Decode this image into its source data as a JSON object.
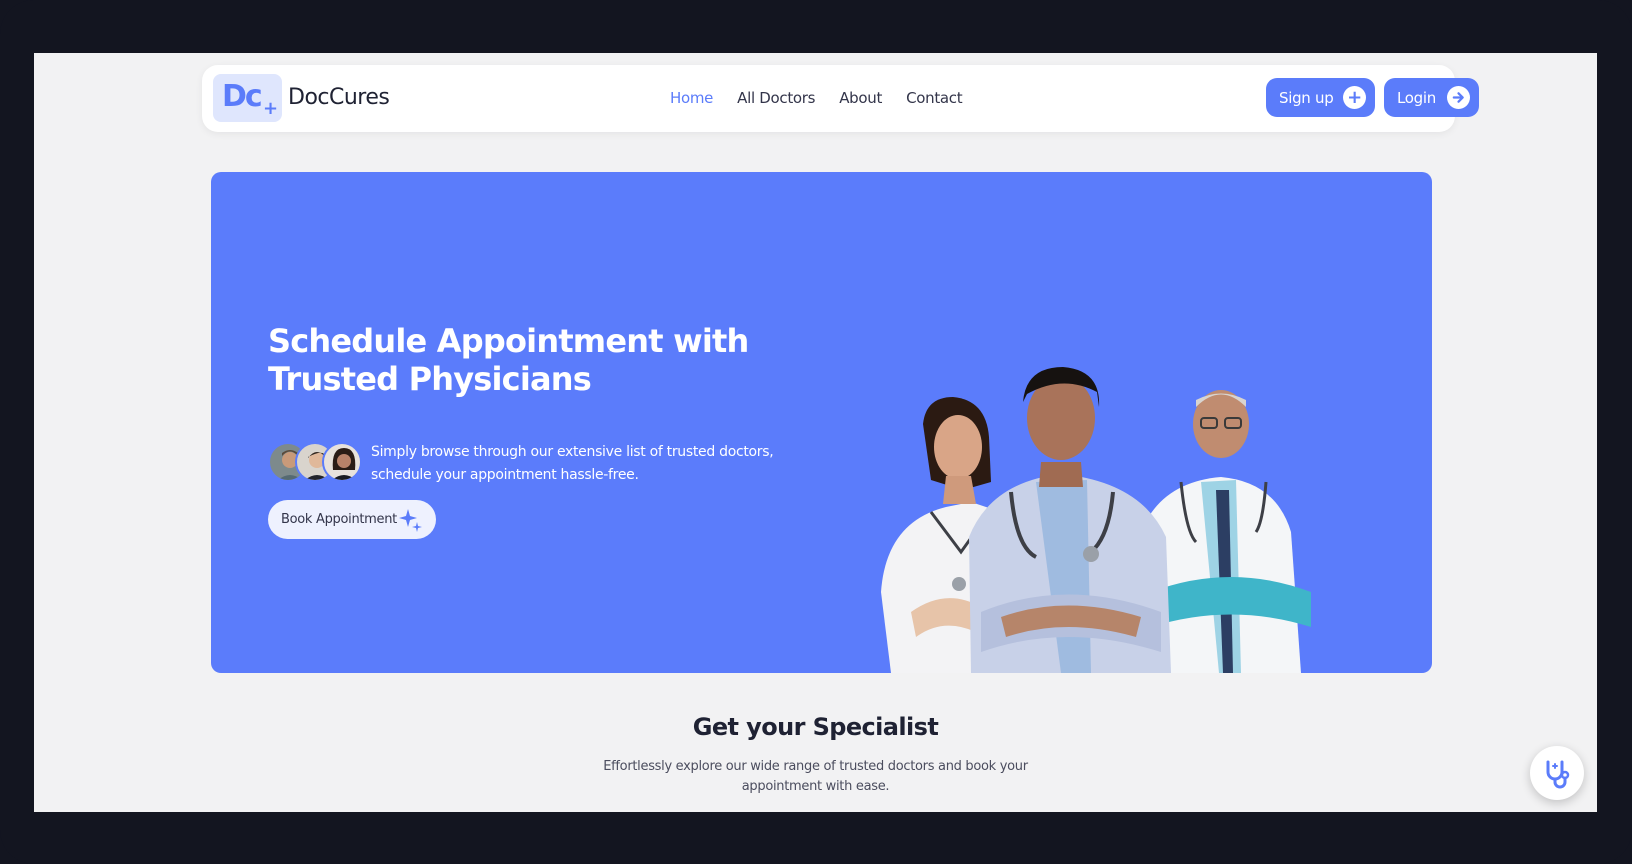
{
  "navbar": {
    "logo_mark": "Dc",
    "brand": "DocCures",
    "links": [
      "Home",
      "All Doctors",
      "About",
      "Contact"
    ],
    "active_link": "Home",
    "signup_label": "Sign up",
    "login_label": "Login"
  },
  "hero": {
    "title_line1": "Schedule Appointment with",
    "title_line2": "Trusted Physicians",
    "description_line1": "Simply browse through our extensive list of trusted doctors,",
    "description_line2": "schedule your appointment hassle-free.",
    "book_label": "Book Appointment"
  },
  "section": {
    "title": "Get your Specialist",
    "subtitle": "Effortlessly explore our wide range of trusted doctors and book your appointment with ease."
  },
  "colors": {
    "accent": "#5b7cfa",
    "hero_bg": "#5b7cfb",
    "page_bg": "#f2f2f3",
    "frame_bg": "#131520"
  },
  "icons": {
    "signup": "plus-circle-icon",
    "login": "arrow-right-circle-icon",
    "book": "sparkle-icon",
    "fab": "stethoscope-icon"
  }
}
